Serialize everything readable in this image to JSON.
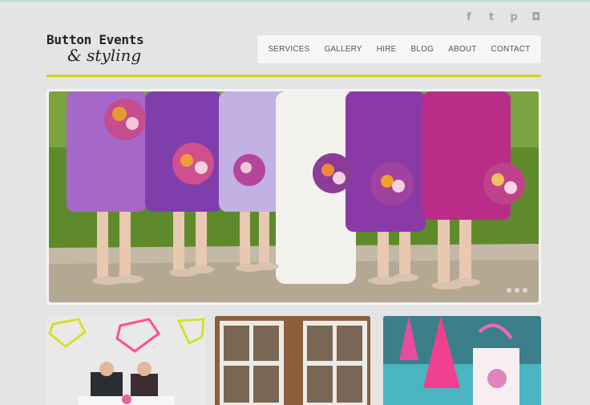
{
  "brand": {
    "line1": "Button Events",
    "line2": "& styling"
  },
  "social": [
    {
      "icon": "facebook-icon",
      "glyph": "f"
    },
    {
      "icon": "twitter-icon",
      "glyph": "t"
    },
    {
      "icon": "pinterest-icon",
      "glyph": "p"
    },
    {
      "icon": "instagram-icon",
      "glyph": "◘"
    }
  ],
  "nav": {
    "items": [
      "SERVICES",
      "GALLERY",
      "HIRE",
      "BLOG",
      "ABOUT",
      "CONTACT"
    ]
  },
  "colors": {
    "accent": "#d2d21a",
    "background": "#e4e4e4",
    "nav_text": "#555555"
  },
  "hero": {
    "alt": "Bridesmaids in purple and pink dresses holding bouquets",
    "slide_count": 3
  },
  "thumbnails": [
    {
      "alt": "Couple at table under geometric lanterns"
    },
    {
      "alt": "Window frame seating charts"
    },
    {
      "alt": "Pink party hats and mermaid favour box"
    }
  ]
}
